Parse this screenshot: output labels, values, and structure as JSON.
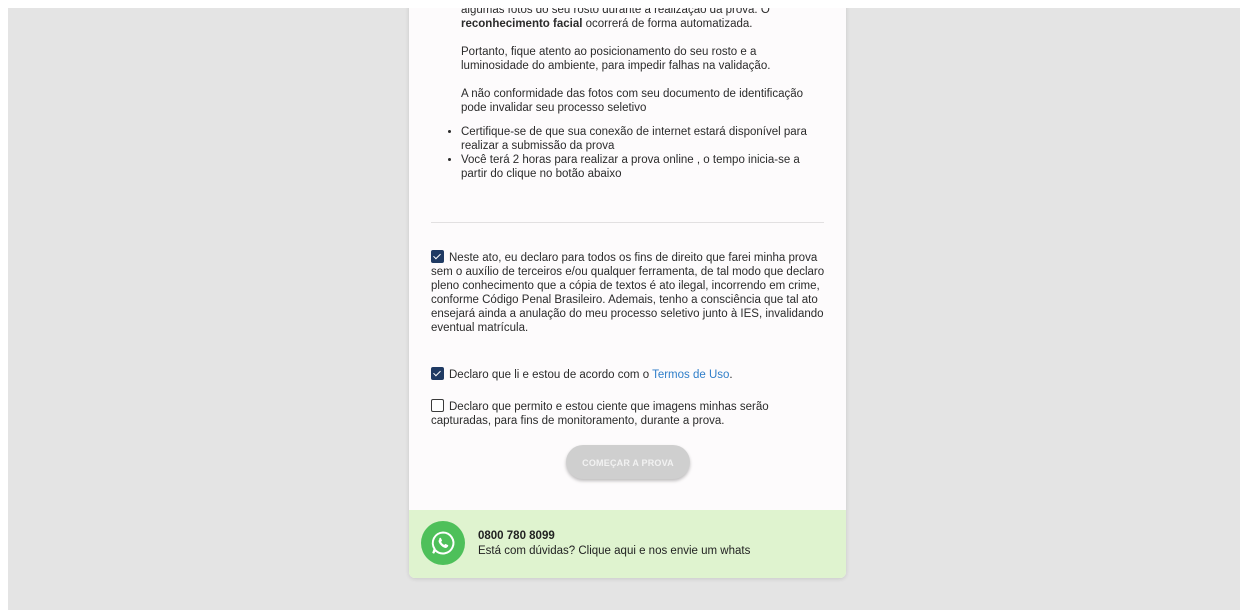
{
  "instructions": {
    "photo_line1": "algumas fotos do seu rosto durante a realização da prova. O",
    "photo_bold": "reconhecimento facial",
    "photo_line2_rest": " ocorrerá de forma automatizada.",
    "position_para": "Portanto, fique atento ao posicionamento do seu rosto e a luminosidade do ambiente, para impedir falhas na validação.",
    "nonconformity_para": "A não conformidade das fotos com seu documento de identificação pode invalidar seu processo seletivo",
    "bullets": [
      "Certifique-se de que sua conexão de internet estará disponível para realizar a submissão da prova",
      "Você terá 2 horas para realizar a prova online , o tempo inicia-se a partir do clique no botão abaixo"
    ]
  },
  "declarations": {
    "honesty": {
      "checked": true,
      "text": "Neste ato, eu declaro para todos os fins de direito que farei minha prova sem o auxílio de terceiros e/ou qualquer ferramenta, de tal modo que declaro pleno conhecimento que a cópia de textos é ato ilegal, incorrendo em crime, conforme Código Penal Brasileiro. Ademais, tenho a consciência que tal ato ensejará ainda a anulação do meu processo seletivo junto à IES, invalidando eventual matrícula."
    },
    "terms": {
      "checked": true,
      "text": "Declaro que li e estou de acordo com o ",
      "link": "Termos de Uso",
      "end": "."
    },
    "images": {
      "checked": false,
      "text": "Declaro que permito e estou ciente que imagens minhas serão capturadas, para fins de monitoramento, durante a prova."
    }
  },
  "start_button": {
    "label": "COMEÇAR A PROVA",
    "enabled": false
  },
  "whatsapp": {
    "phone": "0800 780 8099",
    "help_text": "Está com dúvidas? Clique aqui e nos envie um whats",
    "icon": "whatsapp-icon",
    "color": "#4ec05a"
  },
  "colors": {
    "checkbox": "#1f3a63",
    "link": "#2f7ec9",
    "footer_bg": "#dff3cf",
    "page_bg": "#e4e4e4"
  }
}
